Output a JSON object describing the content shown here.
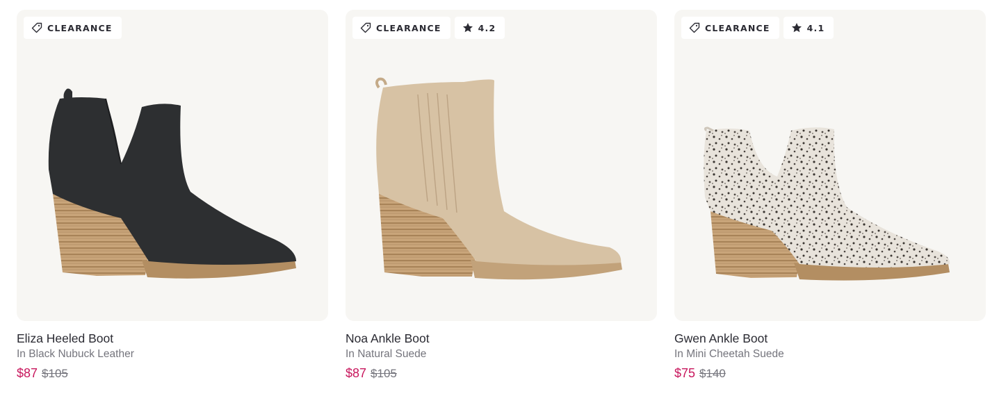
{
  "colors": {
    "sale_price": "#c8175d",
    "card_background": "#f7f6f3",
    "text": "#2b2b33",
    "muted_text": "#74747c"
  },
  "products": [
    {
      "badge": {
        "icon": "tag-icon",
        "label": "CLEARANCE"
      },
      "rating": null,
      "name": "Eliza Heeled Boot",
      "variant": "In Black Nubuck Leather",
      "sale_price": "$87",
      "original_price": "$105"
    },
    {
      "badge": {
        "icon": "tag-icon",
        "label": "CLEARANCE"
      },
      "rating": {
        "icon": "star-icon",
        "value": "4.2"
      },
      "name": "Noa Ankle Boot",
      "variant": "In Natural Suede",
      "sale_price": "$87",
      "original_price": "$105"
    },
    {
      "badge": {
        "icon": "tag-icon",
        "label": "CLEARANCE"
      },
      "rating": {
        "icon": "star-icon",
        "value": "4.1"
      },
      "name": "Gwen Ankle Boot",
      "variant": "In Mini Cheetah Suede",
      "sale_price": "$75",
      "original_price": "$140"
    }
  ]
}
